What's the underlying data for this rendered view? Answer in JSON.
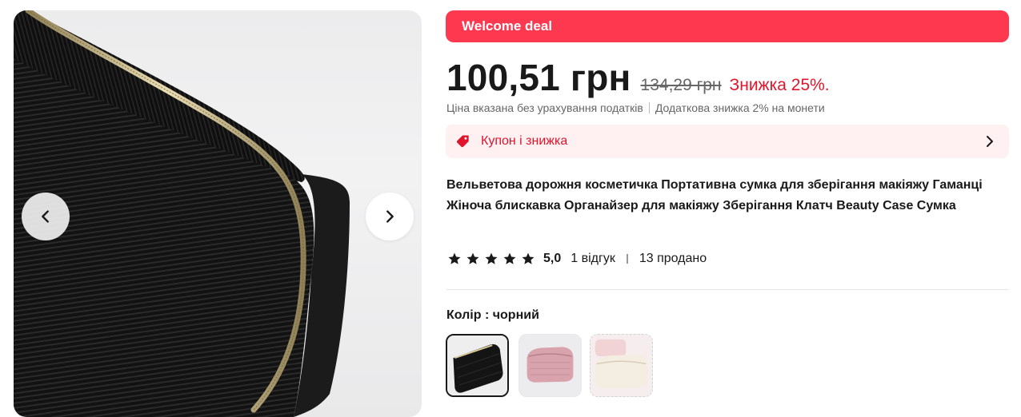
{
  "gallery": {
    "prev_icon": "chevron-left-icon",
    "next_icon": "chevron-right-icon"
  },
  "deal": {
    "label": "Welcome deal",
    "color": "#fd384f"
  },
  "price": {
    "current": "100,51 грн",
    "original": "134,29 грн",
    "discount": "Знижка 25%."
  },
  "tax": {
    "note": "Ціна вказана без урахування податків",
    "coin_discount": "Додаткова знижка 2% на монети"
  },
  "coupon": {
    "label": "Купон і знижка",
    "icon": "tag-icon",
    "chevron": "chevron-right-icon"
  },
  "product": {
    "title": "Вельветова дорожня косметичка Портативна сумка для зберігання макіяжу Гаманці Жіноча блискавка Органайзер для макіяжу Зберігання Клатч Beauty Case Сумка"
  },
  "rating": {
    "stars": 5,
    "score": "5,0",
    "reviews": "1 відгук",
    "sold": "13 продано"
  },
  "color": {
    "label": "Колір : чорний",
    "options": [
      "чорний",
      "рожевий",
      "білий"
    ],
    "selected": "чорний"
  }
}
